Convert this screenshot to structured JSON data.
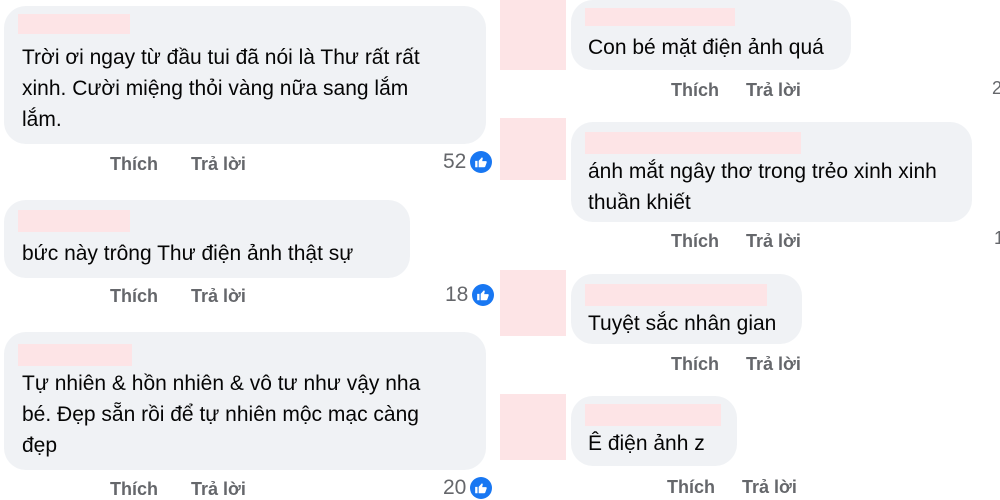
{
  "left_comments": [
    {
      "text_lines": [
        "Trời ơi ngay từ đầu tui đã nói là Thư rất rất",
        "xinh. Cười miệng thỏi vàng nữa sang lắm",
        "lắm."
      ],
      "like_label": "Thích",
      "reply_label": "Trả lời",
      "like_count": "52"
    },
    {
      "text_lines": [
        "bức này trông Thư điện ảnh thật sự"
      ],
      "like_label": "Thích",
      "reply_label": "Trả lời",
      "like_count": "18"
    },
    {
      "text_lines": [
        "Tự nhiên & hồn nhiên & vô tư như vậy nha",
        "bé. Đẹp sẵn rồi để tự nhiên mộc mạc càng",
        "đẹp"
      ],
      "like_label": "Thích",
      "reply_label": "Trả lời",
      "like_count": "20"
    }
  ],
  "right_comments": [
    {
      "text_lines": [
        "Con bé mặt điện ảnh quá"
      ],
      "like_label": "Thích",
      "reply_label": "Trả lời"
    },
    {
      "text_lines": [
        "ánh mắt ngây thơ trong trẻo xinh xinh",
        "thuần khiết"
      ],
      "like_label": "Thích",
      "reply_label": "Trả lời"
    },
    {
      "text_lines": [
        "Tuyệt sắc nhân gian"
      ],
      "like_label": "Thích",
      "reply_label": "Trả lời"
    },
    {
      "text_lines": [
        "Ê điện ảnh z"
      ],
      "like_label": "Thích",
      "reply_label": "Trả lời"
    }
  ],
  "edge_digits": [
    "2",
    "1"
  ],
  "colors": {
    "bubble": "#f0f2f5",
    "like_icon": "#1877f2",
    "redaction": "#fde4e6",
    "muted_text": "#65676b"
  }
}
